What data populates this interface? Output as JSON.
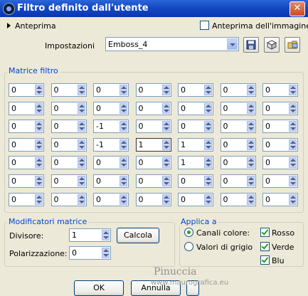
{
  "window": {
    "title": "Filtro definito dall'utente",
    "close_glyph": "✕"
  },
  "preview_toggle": {
    "label": "Anteprima"
  },
  "image_preview": {
    "label": "Anteprima dell'immagine",
    "checked": false
  },
  "settings": {
    "label": "Impostazioni",
    "value": "Emboss_4"
  },
  "matrix": {
    "label": "Matrice filtro",
    "rows": [
      [
        "0",
        "0",
        "0",
        "0",
        "0",
        "0",
        "0"
      ],
      [
        "0",
        "0",
        "0",
        "0",
        "0",
        "0",
        "0"
      ],
      [
        "0",
        "0",
        "-1",
        "0",
        "0",
        "0",
        "0"
      ],
      [
        "0",
        "0",
        "-1",
        "1",
        "1",
        "0",
        "0"
      ],
      [
        "0",
        "0",
        "0",
        "0",
        "1",
        "0",
        "0"
      ],
      [
        "0",
        "0",
        "0",
        "0",
        "0",
        "0",
        "0"
      ],
      [
        "0",
        "0",
        "0",
        "0",
        "0",
        "0",
        "0"
      ]
    ]
  },
  "modifiers": {
    "label": "Modificatori matrice",
    "divisor_label": "Divisore:",
    "divisor_value": "1",
    "calc_label": "Calcola",
    "bias_label": "Polarizzazione:",
    "bias_value": "0"
  },
  "apply": {
    "label": "Applica a",
    "color_channels": "Canali colore:",
    "grayscale": "Valori di grigio",
    "red": "Rosso",
    "green": "Verde",
    "blue": "Blu"
  },
  "buttons": {
    "ok": "OK",
    "cancel": "Annulla"
  },
  "watermark": {
    "name": "Pinuccia",
    "site": "www.maurografica.eu"
  }
}
